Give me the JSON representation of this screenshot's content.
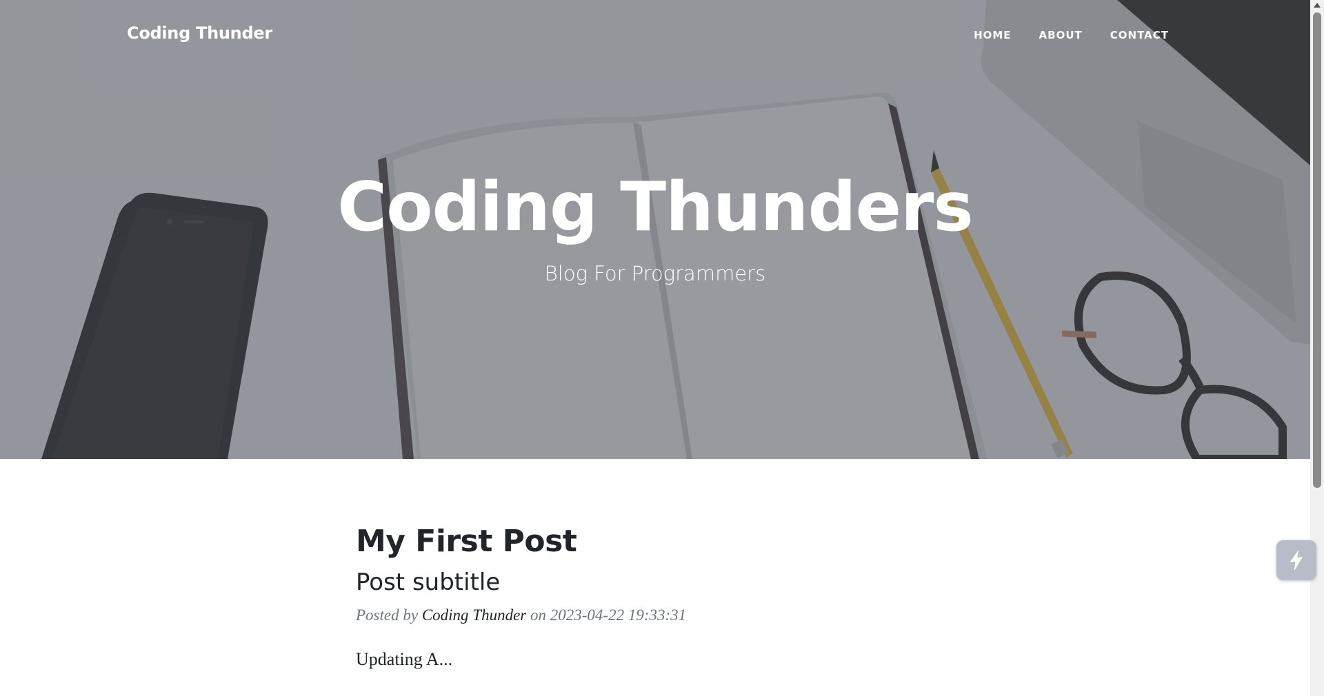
{
  "navbar": {
    "brand": "Coding Thunder",
    "links": [
      {
        "label": "HOME"
      },
      {
        "label": "ABOUT"
      },
      {
        "label": "CONTACT"
      }
    ]
  },
  "hero": {
    "heading": "Coding Thunders",
    "subheading": "Blog For Programmers"
  },
  "post": {
    "title": "My First Post",
    "subtitle": "Post subtitle",
    "meta_prefix": "Posted by",
    "author": "Coding Thunder",
    "meta_on": "on",
    "date": "2023-04-22 19:33:31",
    "excerpt": "Updating A..."
  },
  "icons": {
    "floating_widget": "lightning-app-icon",
    "scroll_up": "chevron-up-icon"
  },
  "colors": {
    "text_dark": "#212529",
    "text_muted": "#6c757d",
    "hero_overlay": "#4b4e56"
  }
}
